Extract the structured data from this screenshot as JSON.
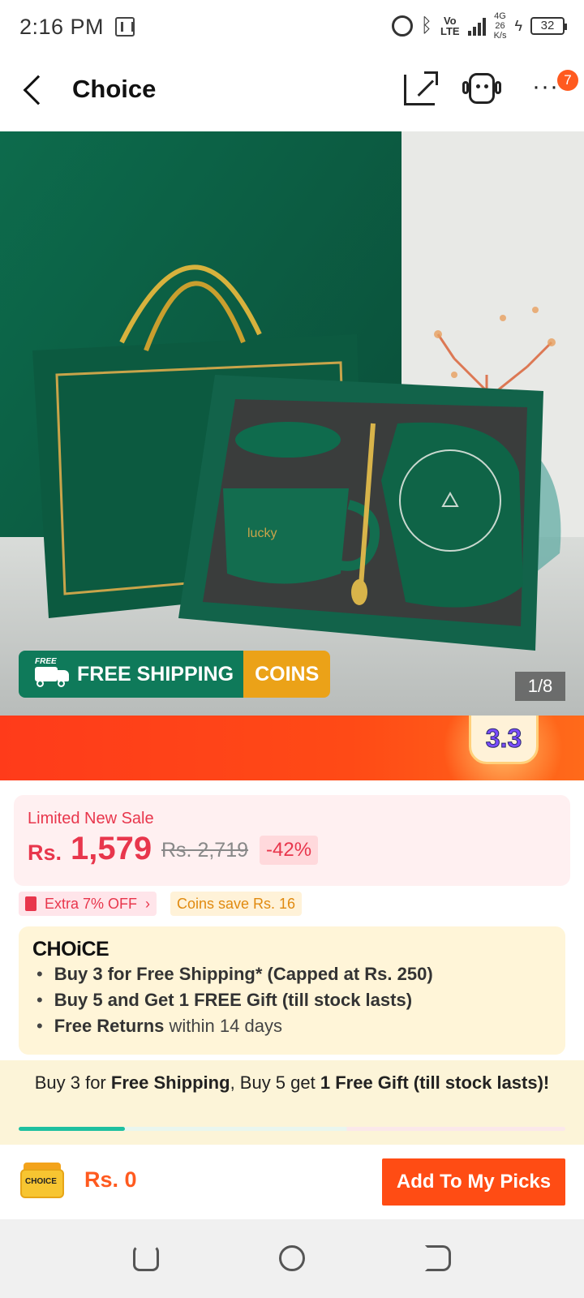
{
  "status_bar": {
    "time": "2:16 PM",
    "network_gen": "4G",
    "volte": "Vo\nLTE",
    "speed_value": "26",
    "speed_unit": "K/s",
    "battery": "32"
  },
  "header": {
    "title": "Choice",
    "cart_badge": "7",
    "icons": [
      "back-icon",
      "share-icon",
      "customer-service-icon",
      "more-icon"
    ]
  },
  "hero": {
    "product_text": "lucky",
    "promo_free_tag": "FREE",
    "promo_free_shipping": "FREE SHIPPING",
    "promo_coins": "COINS",
    "page_indicator": "1/8"
  },
  "event": {
    "badge": "3.3"
  },
  "price": {
    "label": "Limited New Sale",
    "currency": "Rs.",
    "value": "1,579",
    "original": "Rs. 2,719",
    "discount": "-42%"
  },
  "coupons": {
    "extra": "Extra 7% OFF",
    "coins": "Coins save Rs. 16"
  },
  "choice": {
    "logo": "CHOiCE",
    "lines": [
      {
        "bold": "Buy 3 for  Free Shipping* (Capped at Rs. 250)",
        "rest": ""
      },
      {
        "bold": "Buy 5 and Get 1 FREE Gift (till stock lasts)",
        "rest": ""
      },
      {
        "bold": "Free Returns",
        "rest": " within 14 days"
      }
    ]
  },
  "ship_promo": {
    "p1": "Buy 3 for ",
    "b1": "Free Shipping",
    "p2": ", Buy 5 get ",
    "b2": "1 Free Gift (till stock lasts)!",
    "progress_fraction": 0.195
  },
  "action_bar": {
    "cart_label": "CHOICE",
    "total": "Rs. 0",
    "add_button": "Add To My Picks"
  },
  "colors": {
    "accent": "#ff4c14",
    "price_red": "#e8364c",
    "choice_green": "#0f7a5a",
    "coins_orange": "#eba218"
  }
}
